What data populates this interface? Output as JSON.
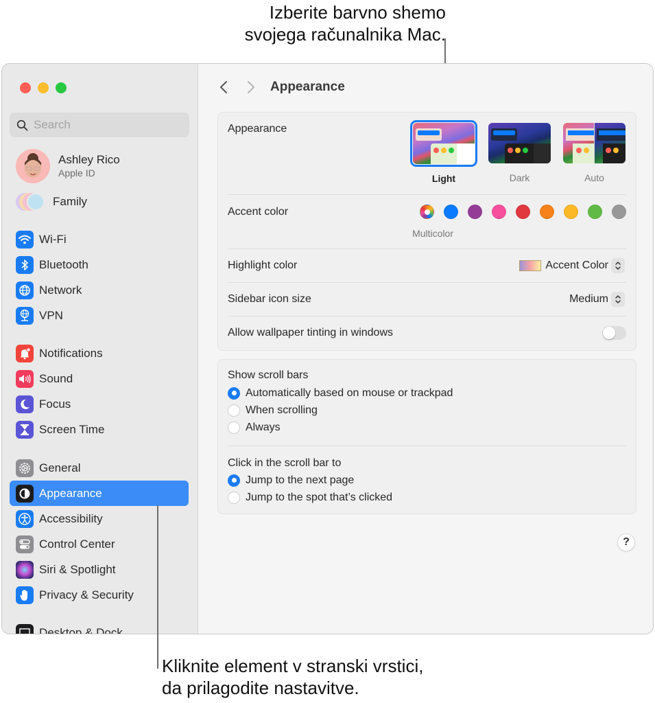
{
  "callouts": {
    "top_line1": "Izberite barvno shemo",
    "top_line2": "svojega računalnika Mac.",
    "bottom_line1": "Kliknite element v stranski vrstici,",
    "bottom_line2": "da prilagodite nastavitve."
  },
  "window": {
    "traffic_lights": {
      "close": "#fe5f57",
      "minimize": "#febc2e",
      "zoom": "#28c840"
    }
  },
  "sidebar": {
    "search_placeholder": "Search",
    "profile": {
      "name": "Ashley Rico",
      "subtitle": "Apple ID"
    },
    "family_label": "Family",
    "items": [
      {
        "label": "Wi-Fi",
        "icon": "wifi-icon",
        "color": "#1a7cf5"
      },
      {
        "label": "Bluetooth",
        "icon": "bluetooth-icon",
        "color": "#1a7cf5"
      },
      {
        "label": "Network",
        "icon": "globe-icon",
        "color": "#1a7cf5"
      },
      {
        "label": "VPN",
        "icon": "vpn-globe-icon",
        "color": "#1a7cf5"
      },
      {
        "label": "Notifications",
        "icon": "bell-icon",
        "color": "#f2443b"
      },
      {
        "label": "Sound",
        "icon": "speaker-icon",
        "color": "#f23b5c"
      },
      {
        "label": "Focus",
        "icon": "moon-icon",
        "color": "#5b55d6"
      },
      {
        "label": "Screen Time",
        "icon": "hourglass-icon",
        "color": "#5b55d6"
      },
      {
        "label": "General",
        "icon": "gear-icon",
        "color": "#8e8e93"
      },
      {
        "label": "Appearance",
        "icon": "appearance-icon",
        "color": "#1c1c1e",
        "selected": true
      },
      {
        "label": "Accessibility",
        "icon": "accessibility-icon",
        "color": "#1a7cf5"
      },
      {
        "label": "Control Center",
        "icon": "toggles-icon",
        "color": "#8e8e93"
      },
      {
        "label": "Siri & Spotlight",
        "icon": "siri-icon",
        "color": "#2b2b5e"
      },
      {
        "label": "Privacy & Security",
        "icon": "hand-icon",
        "color": "#1a7cf5"
      },
      {
        "label": "Desktop & Dock",
        "icon": "desktop-icon",
        "color": "#1c1c1e"
      }
    ]
  },
  "main": {
    "title": "Appearance",
    "appearance": {
      "label": "Appearance",
      "options": [
        {
          "label": "Light",
          "selected": true
        },
        {
          "label": "Dark",
          "selected": false
        },
        {
          "label": "Auto",
          "selected": false
        }
      ]
    },
    "accent": {
      "label": "Accent color",
      "selected_label": "Multicolor",
      "colors": [
        {
          "name": "Multicolor",
          "hex": "multicolor",
          "selected": true
        },
        {
          "name": "Blue",
          "hex": "#0a7aff"
        },
        {
          "name": "Purple",
          "hex": "#953d96"
        },
        {
          "name": "Pink",
          "hex": "#f74f9e"
        },
        {
          "name": "Red",
          "hex": "#e0383e"
        },
        {
          "name": "Orange",
          "hex": "#f7821b"
        },
        {
          "name": "Yellow",
          "hex": "#fcb827"
        },
        {
          "name": "Green",
          "hex": "#62ba46"
        },
        {
          "name": "Graphite",
          "hex": "#989898"
        }
      ]
    },
    "highlight": {
      "label": "Highlight color",
      "value": "Accent Color"
    },
    "sidebar_icon_size": {
      "label": "Sidebar icon size",
      "value": "Medium"
    },
    "wallpaper_tinting": {
      "label": "Allow wallpaper tinting in windows",
      "enabled": false
    },
    "scroll_bars": {
      "label": "Show scroll bars",
      "options": [
        {
          "label": "Automatically based on mouse or trackpad",
          "selected": true
        },
        {
          "label": "When scrolling",
          "selected": false
        },
        {
          "label": "Always",
          "selected": false
        }
      ]
    },
    "click_scroll": {
      "label": "Click in the scroll bar to",
      "options": [
        {
          "label": "Jump to the next page",
          "selected": true
        },
        {
          "label": "Jump to the spot that’s clicked",
          "selected": false
        }
      ]
    },
    "help_label": "?"
  }
}
